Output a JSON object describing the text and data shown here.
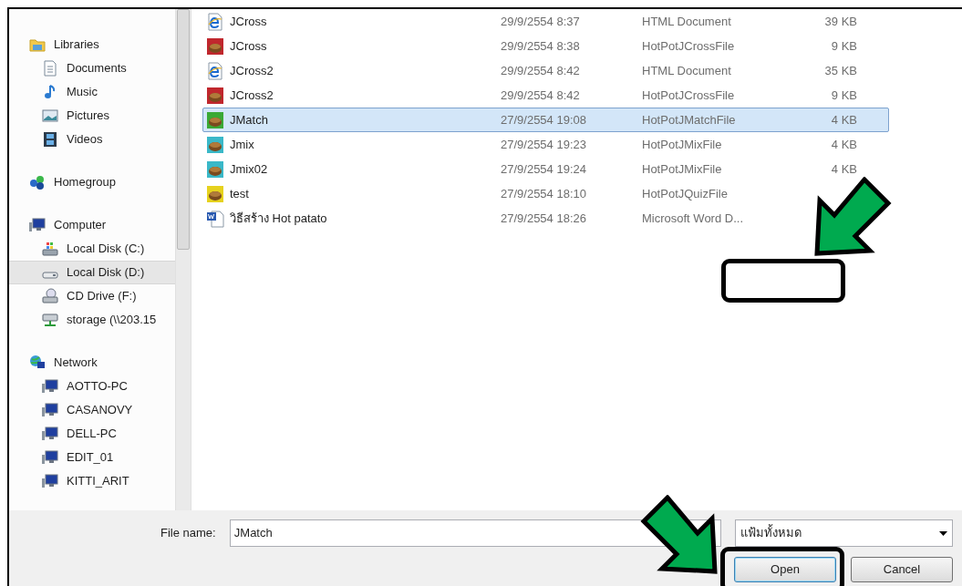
{
  "sidebar": {
    "groups": [
      {
        "label": "Libraries",
        "kind": "library",
        "selected": false,
        "children": [
          {
            "label": "Documents",
            "kind": "documents",
            "selected": false
          },
          {
            "label": "Music",
            "kind": "music",
            "selected": false
          },
          {
            "label": "Pictures",
            "kind": "pictures",
            "selected": false
          },
          {
            "label": "Videos",
            "kind": "videos",
            "selected": false
          }
        ]
      },
      {
        "label": "Homegroup",
        "kind": "homegroup",
        "selected": false
      },
      {
        "label": "Computer",
        "kind": "computer",
        "selected": false,
        "children": [
          {
            "label": "Local Disk (C:)",
            "kind": "system-disk",
            "selected": false
          },
          {
            "label": "Local Disk (D:)",
            "kind": "disk",
            "selected": true
          },
          {
            "label": "CD Drive (F:)",
            "kind": "cd",
            "selected": false
          },
          {
            "label": "storage (\\\\203.15",
            "kind": "net-drive",
            "selected": false
          }
        ]
      },
      {
        "label": "Network",
        "kind": "network",
        "selected": false,
        "children": [
          {
            "label": "AOTTO-PC",
            "kind": "computer",
            "selected": false
          },
          {
            "label": "CASANOVY",
            "kind": "computer",
            "selected": false
          },
          {
            "label": "DELL-PC",
            "kind": "computer",
            "selected": false
          },
          {
            "label": "EDIT_01",
            "kind": "computer",
            "selected": false
          },
          {
            "label": "KITTI_ARIT",
            "kind": "computer",
            "selected": false
          }
        ]
      }
    ]
  },
  "files": [
    {
      "name": "JCross",
      "kind": "html",
      "date": "29/9/2554 8:37",
      "type": "HTML Document",
      "size": "39 KB",
      "selected": false
    },
    {
      "name": "JCross",
      "kind": "hotpot",
      "color": "#c0272d",
      "date": "29/9/2554 8:38",
      "type": "HotPotJCrossFile",
      "size": "9 KB",
      "selected": false
    },
    {
      "name": "JCross2",
      "kind": "html",
      "date": "29/9/2554 8:42",
      "type": "HTML Document",
      "size": "35 KB",
      "selected": false
    },
    {
      "name": "JCross2",
      "kind": "hotpot",
      "color": "#c0272d",
      "date": "29/9/2554 8:42",
      "type": "HotPotJCrossFile",
      "size": "9 KB",
      "selected": false
    },
    {
      "name": "JMatch",
      "kind": "hotpot",
      "color": "#3aa935",
      "date": "27/9/2554 19:08",
      "type": "HotPotJMatchFile",
      "size": "4 KB",
      "selected": true
    },
    {
      "name": "Jmix",
      "kind": "hotpot",
      "color": "#3ab8c8",
      "date": "27/9/2554 19:23",
      "type": "HotPotJMixFile",
      "size": "4 KB",
      "selected": false
    },
    {
      "name": "Jmix02",
      "kind": "hotpot",
      "color": "#3ab8c8",
      "date": "27/9/2554 19:24",
      "type": "HotPotJMixFile",
      "size": "4 KB",
      "selected": false
    },
    {
      "name": "test",
      "kind": "hotpot",
      "color": "#e6d21e",
      "date": "27/9/2554 18:10",
      "type": "HotPotJQuizFile",
      "selected": false
    },
    {
      "name": "วิธีสร้าง Hot patato",
      "kind": "word",
      "date": "27/9/2554 18:26",
      "type": "Microsoft Word D...",
      "selected": false
    }
  ],
  "footer": {
    "file_name_label": "File name:",
    "file_name_value": "JMatch",
    "file_type": "แฟ้มทั้งหมด",
    "buttons": [
      {
        "label": "Open",
        "selected": true
      },
      {
        "label": "Cancel",
        "selected": false
      }
    ]
  }
}
